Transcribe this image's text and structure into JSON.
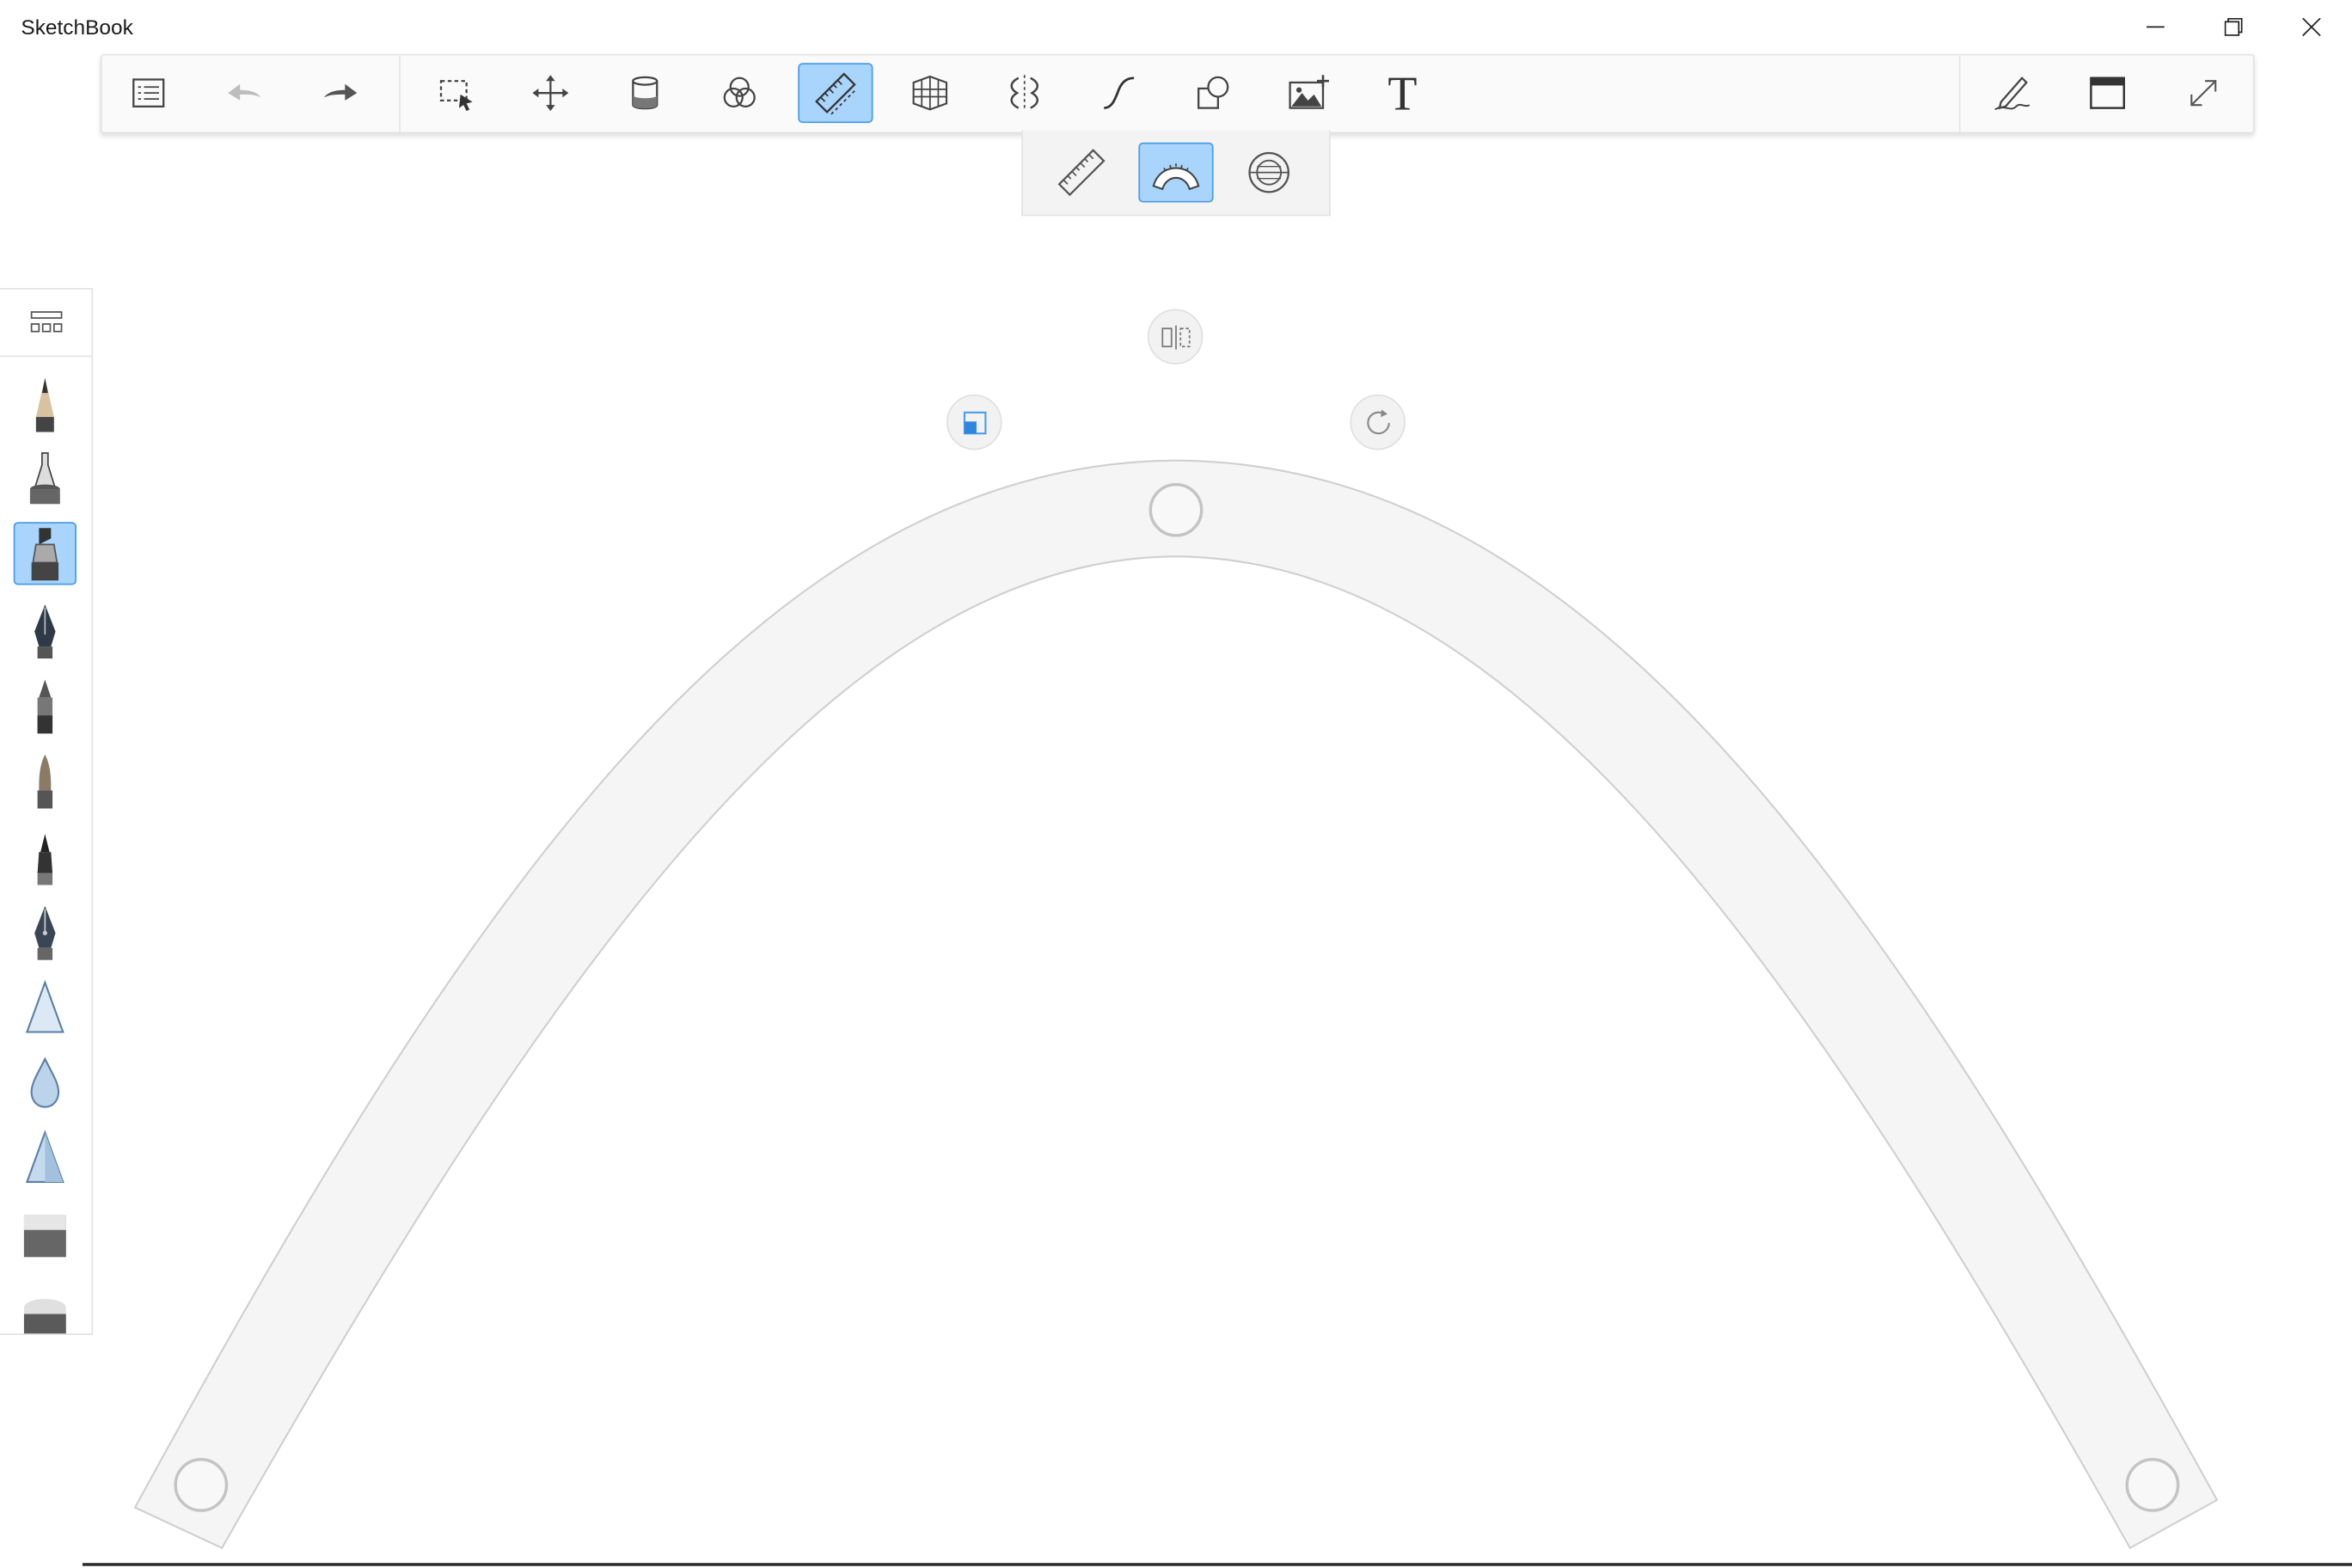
{
  "app": {
    "title": "SketchBook"
  },
  "window_controls": [
    {
      "name": "minimize-button",
      "icon": "minimize-icon"
    },
    {
      "name": "restore-button",
      "icon": "restore-icon"
    },
    {
      "name": "close-button",
      "icon": "close-icon"
    }
  ],
  "toolbar": {
    "left_tools": [
      {
        "name": "layer-list-button",
        "icon": "list-icon"
      },
      {
        "name": "undo-button",
        "icon": "undo-icon",
        "disabled": true
      },
      {
        "name": "redo-button",
        "icon": "redo-icon"
      }
    ],
    "tools": [
      {
        "name": "selection-tool",
        "icon": "marquee-select-icon"
      },
      {
        "name": "transform-tool",
        "icon": "move-arrows-icon"
      },
      {
        "name": "fill-tool",
        "icon": "paint-bucket-icon"
      },
      {
        "name": "color-editor-tool",
        "icon": "color-circles-icon"
      },
      {
        "name": "ruler-tool",
        "icon": "ruler-icon",
        "active": true
      },
      {
        "name": "perspective-tool",
        "icon": "perspective-grid-icon"
      },
      {
        "name": "symmetry-tool",
        "icon": "symmetry-icon"
      },
      {
        "name": "stroke-tool",
        "icon": "curve-stroke-icon"
      },
      {
        "name": "shape-tool",
        "icon": "shapes-icon"
      },
      {
        "name": "add-image-tool",
        "icon": "add-image-icon"
      },
      {
        "name": "text-tool",
        "icon": "text-icon",
        "glyph": "T"
      }
    ],
    "right_tools": [
      {
        "name": "predictive-stroke-button",
        "icon": "pen-signature-icon"
      },
      {
        "name": "toggle-interface-button",
        "icon": "window-icon"
      },
      {
        "name": "fullscreen-button",
        "icon": "expand-icon"
      }
    ]
  },
  "ruler_options": [
    {
      "name": "straight-ruler-button",
      "icon": "straight-ruler-icon"
    },
    {
      "name": "french-curve-button",
      "icon": "french-curve-icon",
      "active": true
    },
    {
      "name": "ellipse-guide-button",
      "icon": "ellipse-guide-icon"
    }
  ],
  "brush_palette": {
    "header_icon": "brush-library-icon",
    "brushes": [
      {
        "name": "pencil-brush"
      },
      {
        "name": "airbrush-brush"
      },
      {
        "name": "marker-brush",
        "active": true
      },
      {
        "name": "ink-pen-brush"
      },
      {
        "name": "ballpoint-brush"
      },
      {
        "name": "paintbrush-brush"
      },
      {
        "name": "felt-tip-brush"
      },
      {
        "name": "calligraphy-brush"
      },
      {
        "name": "smudge-brush"
      },
      {
        "name": "blur-brush"
      },
      {
        "name": "sharpen-brush"
      },
      {
        "name": "hard-eraser-brush"
      },
      {
        "name": "soft-eraser-brush"
      }
    ]
  },
  "colors": {
    "accent": "#a9d4fb",
    "accent_border": "#4a9be8",
    "curve_fill": "#f5f5f5",
    "curve_stroke": "#cfcfcf"
  }
}
